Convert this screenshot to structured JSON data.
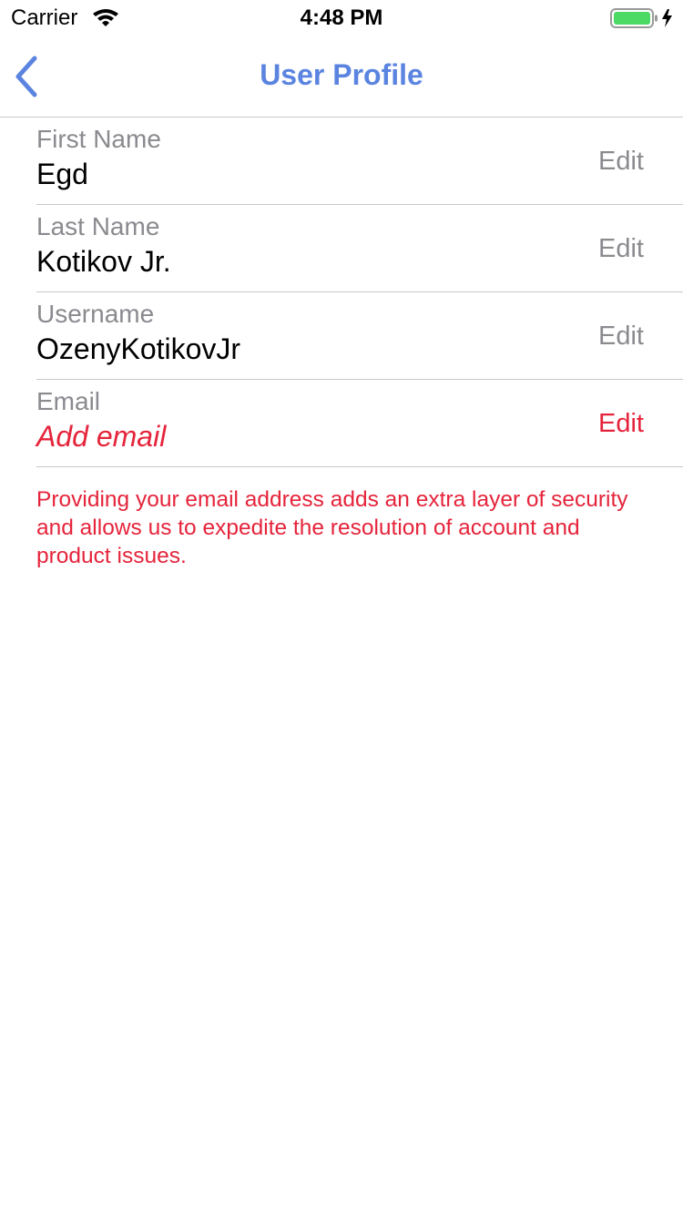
{
  "status_bar": {
    "carrier": "Carrier",
    "time": "4:48 PM",
    "icons": [
      "wifi-icon",
      "battery-icon",
      "charging-bolt-icon"
    ],
    "battery_color": "#4cd964"
  },
  "nav_bar": {
    "title": "User Profile",
    "back_icon": "chevron-left-icon",
    "accent_color": "#5b84e0"
  },
  "profile": {
    "rows": [
      {
        "label": "First Name",
        "value": "Egd",
        "edit_label": "Edit"
      },
      {
        "label": "Last Name",
        "value": "Kotikov Jr.",
        "edit_label": "Edit"
      },
      {
        "label": "Username",
        "value": "OzenyKotikovJr",
        "edit_label": "Edit"
      },
      {
        "label": "Email",
        "value": "Add email",
        "edit_label": "Edit"
      }
    ],
    "email_note": "Providing your email address adds an extra layer of security and allows us to expedite the resolution of account and product issues.",
    "warning_color": "#e5243b"
  }
}
